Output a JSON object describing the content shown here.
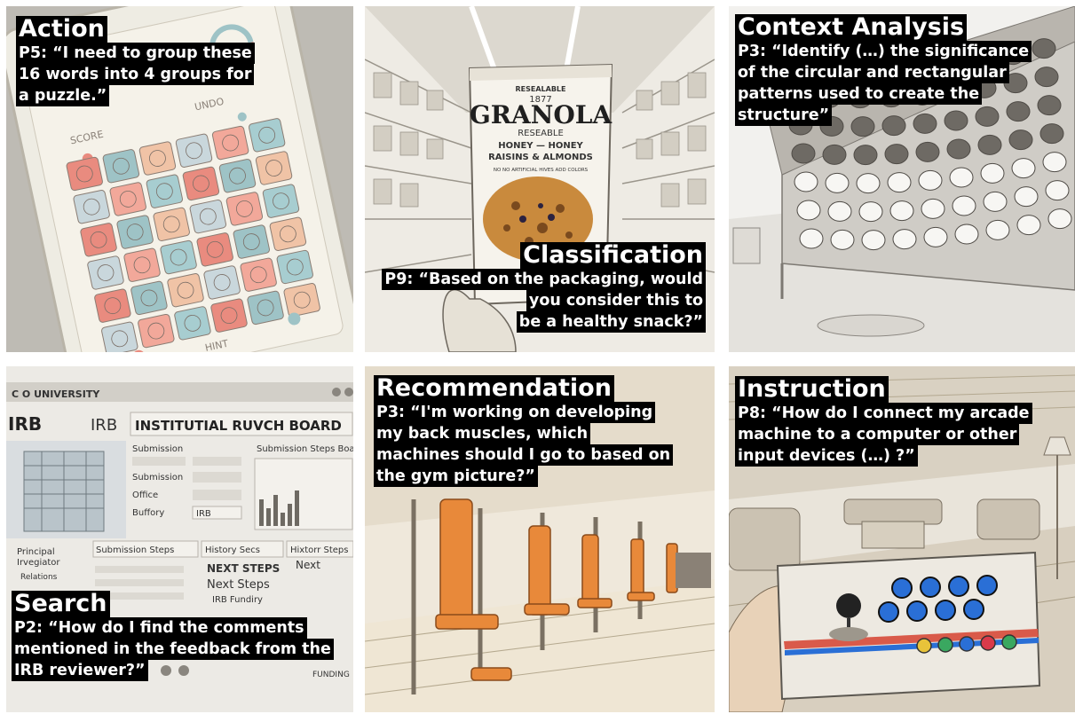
{
  "panels": [
    {
      "category": "Action",
      "quote_lines": [
        "P5: “I need to group these",
        "16 words into 4 groups for",
        "a puzzle.”"
      ],
      "scene_text": {
        "score": "SCORE",
        "undo": "UNDO",
        "hint": "HINT"
      }
    },
    {
      "category": "Classification",
      "quote_lines": [
        "P9: “Based on the packaging, would",
        "you consider this to",
        "be a healthy snack?”"
      ],
      "scene_text": {
        "resealable": "RESEALABLE",
        "year": "1877",
        "brand": "GRANOLA",
        "resealable2": "RESEABLE",
        "flavor1": "HONEY — HONEY",
        "flavor2": "RAISINS & ALMONDS",
        "claim": "NO NO ARTIFICIAL HIVES ADD COLORS"
      }
    },
    {
      "category": "Context Analysis",
      "quote_lines": [
        "P3: “Identify (…) the significance",
        "of the circular and rectangular",
        "patterns used to create the",
        "structure”"
      ]
    },
    {
      "category": "Search",
      "quote_lines": [
        "P2: “How do I find the comments",
        "mentioned in the feedback from the",
        "IRB reviewer?”"
      ],
      "scene_text": {
        "university": "C O UNIVERSITY",
        "irb_logo": "IRB",
        "irb_small": "IRB",
        "board_title": "INSTITUTIAL RUVCH BOARD",
        "submission": "Submission",
        "submission_steps_top": "Submission Steps Boards",
        "submission2": "Submission",
        "field_office": "Office",
        "field_buffory": "Buffory",
        "irb_field": "IRB",
        "principal": "Principal",
        "investigator": "Irvegiator",
        "relations": "Relations",
        "submission_steps": "Submission Steps",
        "history": "History Secs",
        "hixtory": "Hixtorr Steps",
        "next_steps_caps": "NEXT STEPS",
        "next_steps": "Next Steps",
        "irb_funding": "IRB Fundiry",
        "next": "Next",
        "funding": "FUNDING"
      }
    },
    {
      "category": "Recommendation",
      "quote_lines": [
        "P3: “I'm working on developing",
        "my back muscles, which",
        "machines should I go to based on",
        "the gym picture?”"
      ]
    },
    {
      "category": "Instruction",
      "quote_lines": [
        "P8: “How do I connect my arcade",
        "machine to a computer or other",
        "input devices (…) ?”"
      ]
    }
  ],
  "colors": {
    "caption_bg": "#000000",
    "caption_text": "#ffffff",
    "gym_orange": "#e8893a",
    "tile_red": "#e98b7f",
    "tile_teal": "#9ec3c6",
    "arcade_blue": "#2a6fd6"
  }
}
